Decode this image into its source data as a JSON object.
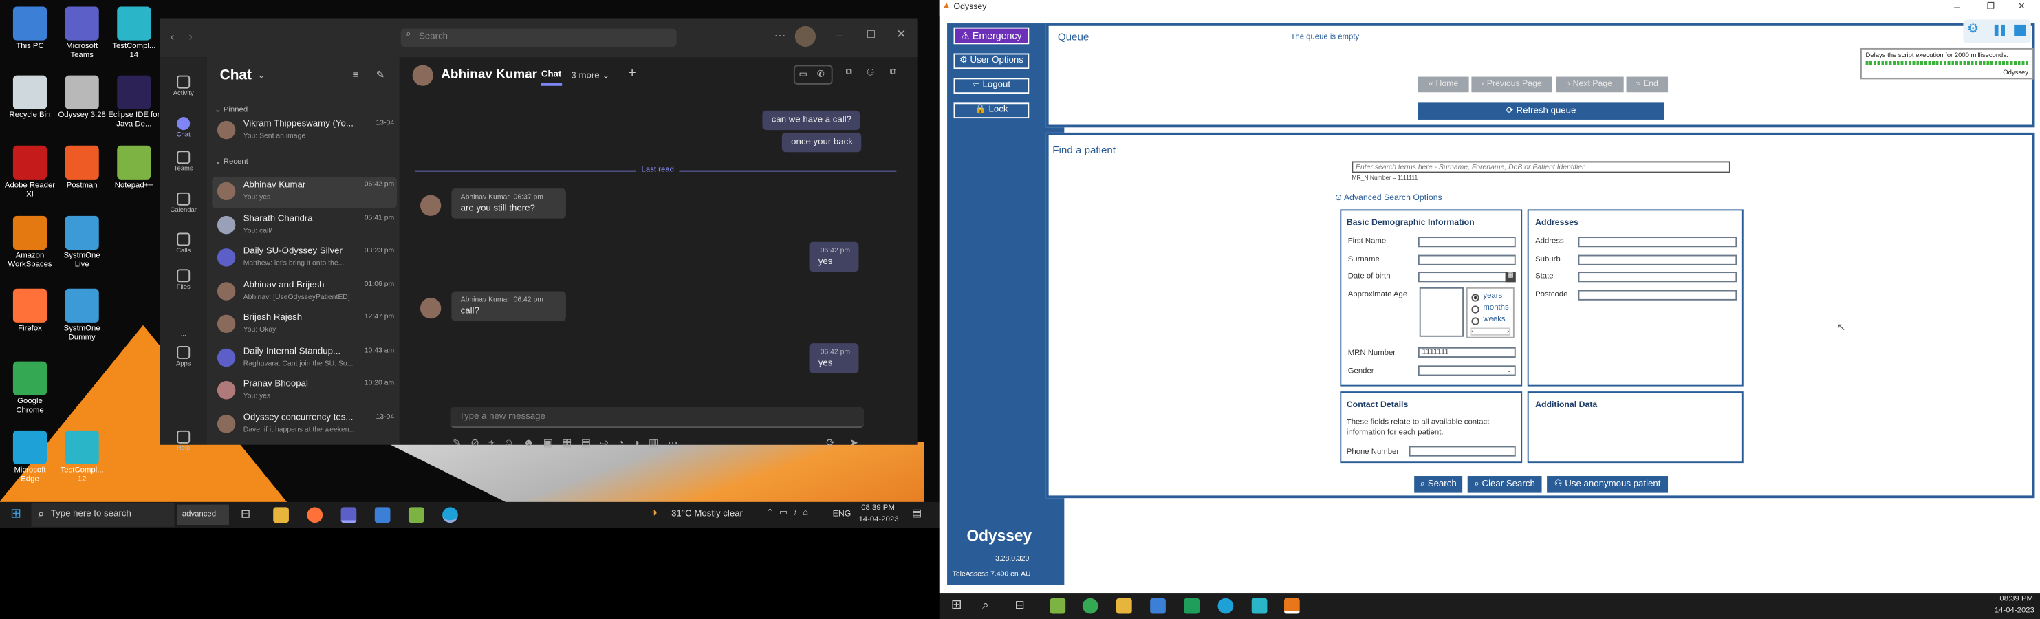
{
  "desktop": {
    "icons": [
      {
        "label": "This PC",
        "icon": "pc-icon",
        "color": "#3c7fd6"
      },
      {
        "label": "Microsoft Teams",
        "icon": "teams-icon",
        "color": "#5b5fc7"
      },
      {
        "label": "TestCompl... 14",
        "icon": "testcomplete-icon",
        "color": "#2bb5c9"
      },
      {
        "label": "Recycle Bin",
        "icon": "recycle-bin-icon",
        "color": "#cfd8dc"
      },
      {
        "label": "Odyssey 3.28",
        "icon": "odyssey-icon",
        "color": "#b8b8b8"
      },
      {
        "label": "Eclipse IDE for Java De...",
        "icon": "eclipse-icon",
        "color": "#2c2255"
      },
      {
        "label": "Adobe Reader XI",
        "icon": "adobe-icon",
        "color": "#c61b1b"
      },
      {
        "label": "Postman",
        "icon": "postman-icon",
        "color": "#ef5b25"
      },
      {
        "label": "Notepad++",
        "icon": "notepadpp-icon",
        "color": "#7cb342"
      },
      {
        "label": "Amazon WorkSpaces",
        "icon": "workspaces-icon",
        "color": "#e47911"
      },
      {
        "label": "SystmOne Live",
        "icon": "systmone-icon",
        "color": "#3c9ad6"
      },
      {
        "label": "Firefox",
        "icon": "firefox-icon",
        "color": "#ff7139"
      },
      {
        "label": "SystmOne Dummy",
        "icon": "systmone-icon",
        "color": "#3c9ad6"
      },
      {
        "label": "Google Chrome",
        "icon": "chrome-icon",
        "color": "#34a853"
      },
      {
        "label": "Microsoft Edge",
        "icon": "edge-icon",
        "color": "#1ea1d6"
      },
      {
        "label": "TestCompl... 12",
        "icon": "testcomplete-icon",
        "color": "#2bb5c9"
      }
    ]
  },
  "teams": {
    "search_placeholder": "Search",
    "rail": [
      "Activity",
      "Chat",
      "Teams",
      "Calendar",
      "Calls",
      "Files",
      "...",
      "Apps",
      "Help"
    ],
    "list_title": "Chat",
    "pinned_label": "Pinned",
    "recent_label": "Recent",
    "chats": [
      {
        "name": "Vikram Thippeswamy (Yo...",
        "time": "13-04",
        "preview": "You: Sent an image"
      },
      {
        "name": "Abhinav Kumar",
        "time": "06:42 pm",
        "preview": "You: yes"
      },
      {
        "name": "Sharath Chandra",
        "time": "05:41 pm",
        "preview": "You: call/"
      },
      {
        "name": "Daily SU-Odyssey Silver",
        "time": "03:23 pm",
        "preview": "Matthew: let's bring it onto the..."
      },
      {
        "name": "Abhinav and Brijesh",
        "time": "01:06 pm",
        "preview": "Abhinav: [UseOdysseyPatientED]"
      },
      {
        "name": "Brijesh Rajesh",
        "time": "12:47 pm",
        "preview": "You: Okay"
      },
      {
        "name": "Daily Internal Standup...",
        "time": "10:43 am",
        "preview": "Raghuvara: Cant join the SU. So..."
      },
      {
        "name": "Pranav Bhoopal",
        "time": "10:20 am",
        "preview": "You: yes"
      },
      {
        "name": "Odyssey concurrency tes...",
        "time": "13-04",
        "preview": "Dave: if it happens at the weeken..."
      }
    ],
    "conv_name": "Abhinav Kumar",
    "conv_tab": "Chat",
    "conv_more": "3 more",
    "msg_out_1": "can we have a call?",
    "msg_out_2": "once your back",
    "last_read": "Last read",
    "msgs": [
      {
        "who": "Abhinav Kumar",
        "time": "06:37 pm",
        "text": "are you still there?"
      },
      {
        "who": "",
        "time": "06:42 pm",
        "text": "yes"
      },
      {
        "who": "Abhinav Kumar",
        "time": "06:42 pm",
        "text": "call?"
      },
      {
        "who": "",
        "time": "06:42 pm",
        "text": "yes"
      }
    ],
    "compose_placeholder": "Type a new message"
  },
  "taskbar_left": {
    "search": "Type here to search",
    "search_badge": "advanced",
    "weather": "31°C  Mostly clear",
    "lang": "ENG",
    "time": "08:39 PM",
    "date": "14-04-2023"
  },
  "odyssey": {
    "window_title": "Odyssey",
    "sidebar": {
      "emergency": "Emergency",
      "user_options": "User Options",
      "logout": "Logout",
      "lock": "Lock",
      "brand": "Odyssey",
      "version": "3.28.0.320",
      "footer": "TeleAssess 7.490 en-AU"
    },
    "queue": {
      "title": "Queue",
      "status": "The queue is empty",
      "nav": [
        "Home",
        "Previous Page",
        "Next Page",
        "End"
      ],
      "refresh": "Refresh queue"
    },
    "tooltip": {
      "text": "Delays the script execution for 2000 milliseconds.",
      "source": "Odyssey"
    },
    "find": {
      "title": "Find a patient",
      "search_placeholder": "Enter search terms here - Surname, Forename, DoB or Patient Identifier",
      "hint": "MR_N Number = 1111111",
      "advanced": "Advanced Search Options",
      "demo_title": "Basic Demographic Information",
      "first_name": "First Name",
      "surname": "Surname",
      "dob": "Date of birth",
      "approx_age": "Approximate Age",
      "age_units": [
        "years",
        "months",
        "weeks"
      ],
      "mrn": "MRN Number",
      "mrn_value": "1111111",
      "gender": "Gender",
      "addr_title": "Addresses",
      "address": "Address",
      "suburb": "Suburb",
      "state": "State",
      "postcode": "Postcode",
      "contact_title": "Contact Details",
      "contact_note": "These fields relate to all available contact information for each patient.",
      "phone": "Phone Number",
      "additional_title": "Additional Data",
      "search_btn": "Search",
      "clear_btn": "Clear Search",
      "anon_btn": "Use anonymous patient"
    }
  },
  "taskbar_right": {
    "time": "08:39 PM",
    "date": "14-04-2023"
  }
}
